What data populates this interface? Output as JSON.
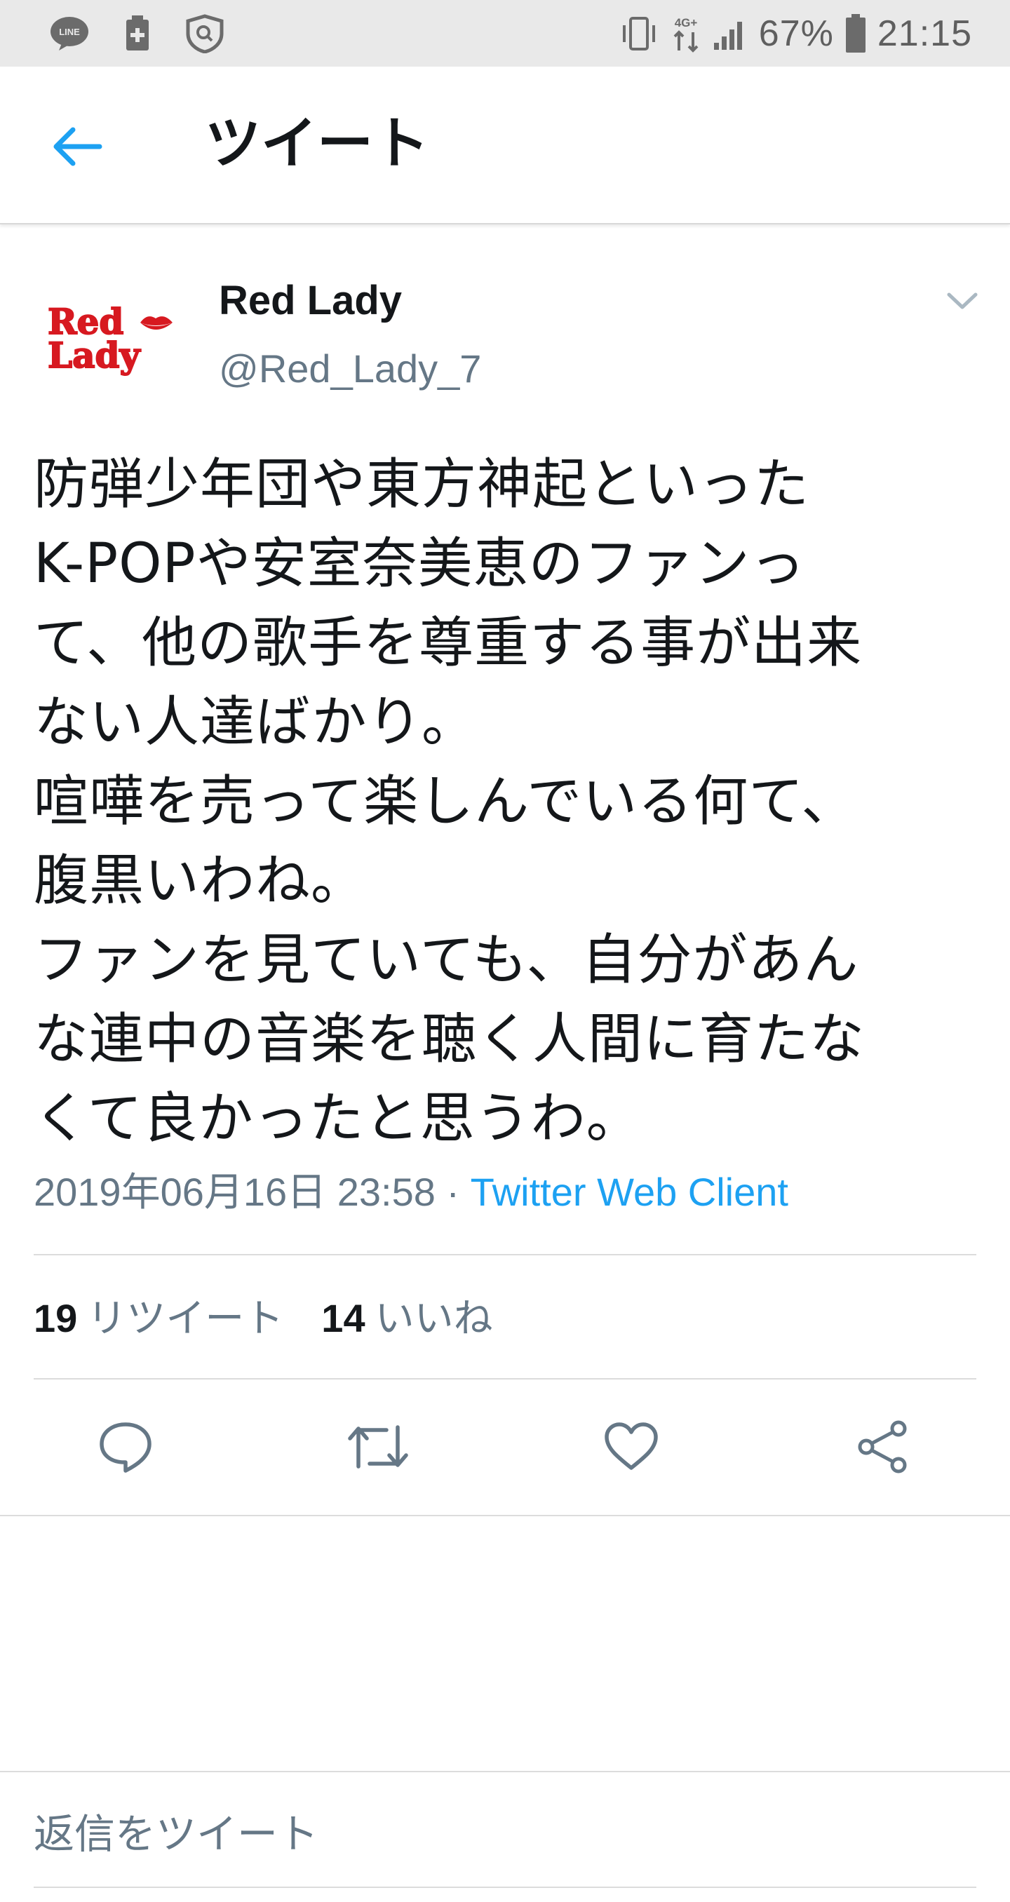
{
  "status_bar": {
    "battery": "67%",
    "time": "21:15",
    "left_icons": [
      "line-icon",
      "medical-icon",
      "shield-icon"
    ],
    "right_icons": [
      "vibrate-icon",
      "data-4g-icon",
      "signal-icon",
      "battery-icon"
    ],
    "network_label": "4G+"
  },
  "header": {
    "title": "ツイート",
    "accent_color": "#1da1f2"
  },
  "tweet": {
    "avatar_logo_text": "Red Lady",
    "author_name": "Red Lady",
    "author_handle": "@Red_Lady_7",
    "text": "防弾少年団や東方神起といった\nK-POPや安室奈美恵のファンっ\nて、他の歌手を尊重する事が出来\nない人達ばかり。\n喧嘩を売って楽しんでいる何て、\n腹黒いわね。\nファンを見ていても、自分があん\nな連中の音楽を聴く人間に育たな\nくて良かったと思うわ。",
    "timestamp": "2019年06月16日 23:58",
    "separator": " · ",
    "client": "Twitter Web Client",
    "retweet_count": "19",
    "retweet_label": "リツイート",
    "like_count": "14",
    "like_label": "いいね"
  },
  "actions": {
    "icons": [
      "reply-icon",
      "retweet-icon",
      "like-icon",
      "share-icon"
    ]
  },
  "reply_box": {
    "placeholder": "返信をツイート"
  }
}
